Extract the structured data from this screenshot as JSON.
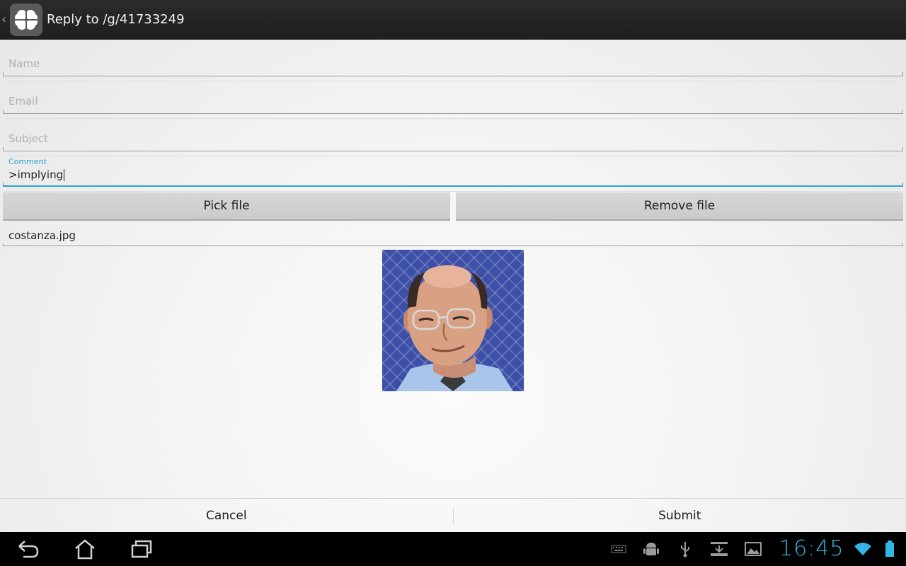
{
  "actionbar": {
    "title": "Reply to /g/41733249",
    "up_caret": "‹"
  },
  "form": {
    "name": {
      "placeholder": "Name",
      "value": ""
    },
    "email": {
      "placeholder": "Email",
      "value": ""
    },
    "subject": {
      "placeholder": "Subject",
      "value": ""
    },
    "comment": {
      "label": "Comment",
      "value": ">implying"
    }
  },
  "buttons": {
    "pick_file": "Pick file",
    "remove_file": "Remove file"
  },
  "file": {
    "name": "costanza.jpg"
  },
  "dialog": {
    "cancel": "Cancel",
    "submit": "Submit"
  },
  "system": {
    "clock": "16:45",
    "accent_color": "#33b5e5"
  },
  "icons": {
    "app": "four-leaf-clover-icon",
    "back": "back-icon",
    "home": "home-icon",
    "recents": "recent-apps-icon",
    "keyboard": "keyboard-icon",
    "android": "android-debug-icon",
    "usb": "usb-icon",
    "download": "download-icon",
    "image": "image-icon",
    "wifi": "wifi-icon",
    "battery": "battery-icon"
  }
}
